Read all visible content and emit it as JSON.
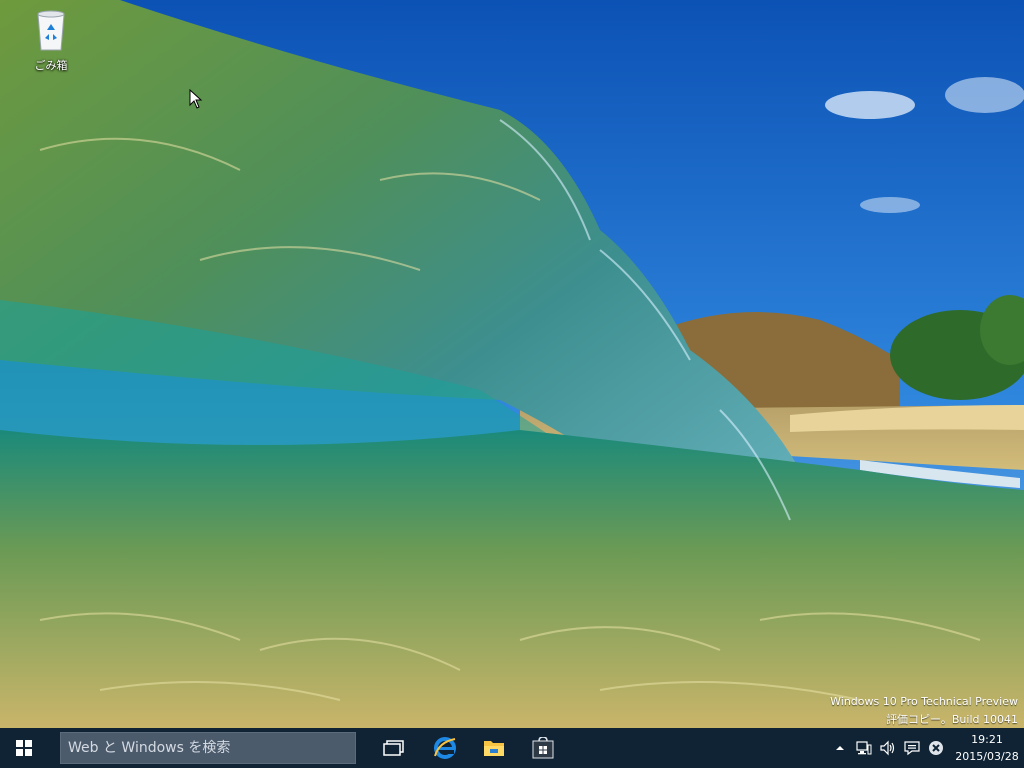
{
  "desktop": {
    "icons": [
      {
        "label": "ごみ箱",
        "icon": "recycle-bin-icon"
      }
    ]
  },
  "watermark": {
    "line1": "Windows 10 Pro Technical Preview",
    "line2": "評価コピー。Build 10041"
  },
  "taskbar": {
    "start_icon": "windows-logo-icon",
    "search": {
      "placeholder": "Web と Windows を検索",
      "value": ""
    },
    "apps": [
      {
        "icon": "task-view-icon"
      },
      {
        "icon": "internet-explorer-icon"
      },
      {
        "icon": "file-explorer-icon"
      },
      {
        "icon": "store-icon"
      }
    ],
    "tray": {
      "icons": [
        "show-hidden-icons-icon",
        "network-icon",
        "volume-icon",
        "action-center-icon",
        "notification-error-icon"
      ],
      "clock": {
        "time": "19:21",
        "date": "2015/03/28"
      }
    }
  },
  "colors": {
    "taskbar": "#0f2334",
    "search_bg": "#4c5b6c",
    "ie_blue": "#1e88e5",
    "folder_yellow": "#f6c342"
  }
}
